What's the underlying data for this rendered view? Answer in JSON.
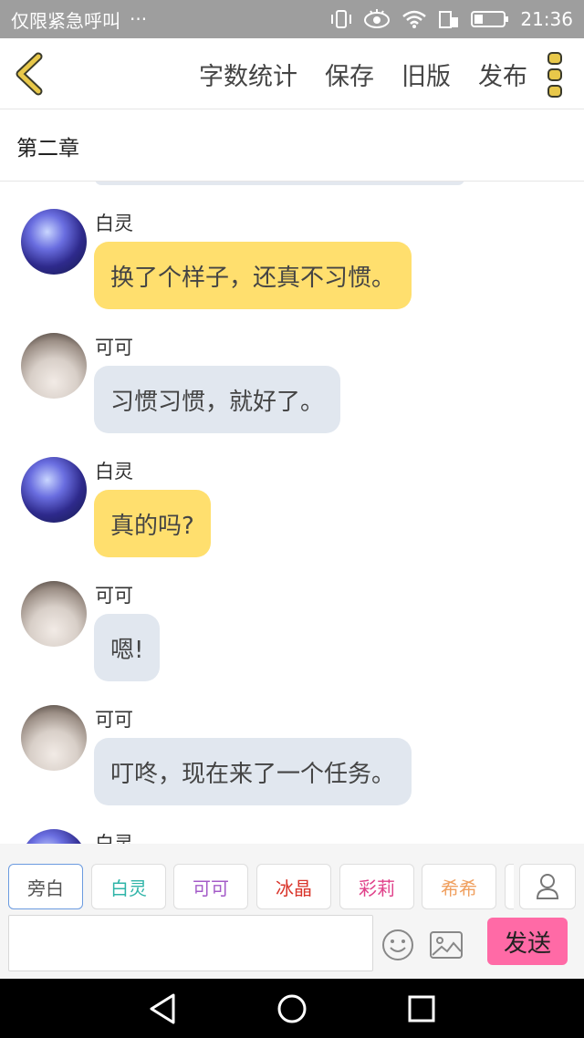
{
  "status_bar": {
    "carrier": "仅限紧急呼叫",
    "more": "···",
    "time": "21:36"
  },
  "header": {
    "actions": [
      "字数统计",
      "保存",
      "旧版",
      "发布"
    ]
  },
  "chapter": {
    "title": "第二章"
  },
  "messages": [
    {
      "avatar": "bailing-avatar",
      "name": "白灵",
      "text": "换了个样子，还真不习惯。",
      "style": "yellow"
    },
    {
      "avatar": "keke-avatar",
      "name": "可可",
      "text": "习惯习惯，就好了。",
      "style": "gray"
    },
    {
      "avatar": "bailing-avatar",
      "name": "白灵",
      "text": "真的吗?",
      "style": "yellow"
    },
    {
      "avatar": "keke-avatar",
      "name": "可可",
      "text": "嗯!",
      "style": "gray"
    },
    {
      "avatar": "keke-avatar",
      "name": "可可",
      "text": "叮咚，现在来了一个任务。",
      "style": "gray"
    },
    {
      "avatar": "bailing-avatar",
      "name": "白灵",
      "text": "",
      "style": "yellow"
    }
  ],
  "roles": [
    {
      "label": "旁白",
      "color": "#555555"
    },
    {
      "label": "白灵",
      "color": "#2fb4a8"
    },
    {
      "label": "可可",
      "color": "#a45bc8"
    },
    {
      "label": "冰晶",
      "color": "#d9352b"
    },
    {
      "label": "彩莉",
      "color": "#e0418a"
    },
    {
      "label": "希希",
      "color": "#f0a060"
    }
  ],
  "input": {
    "value": "",
    "placeholder": ""
  },
  "send_label": "发送",
  "colors": {
    "accent_yellow": "#ffdf6e",
    "bubble_gray": "#e1e7ef",
    "send_pink": "#ff6aa6",
    "active_role_border": "#6b9be0",
    "back_icon": "#e8c84a"
  }
}
